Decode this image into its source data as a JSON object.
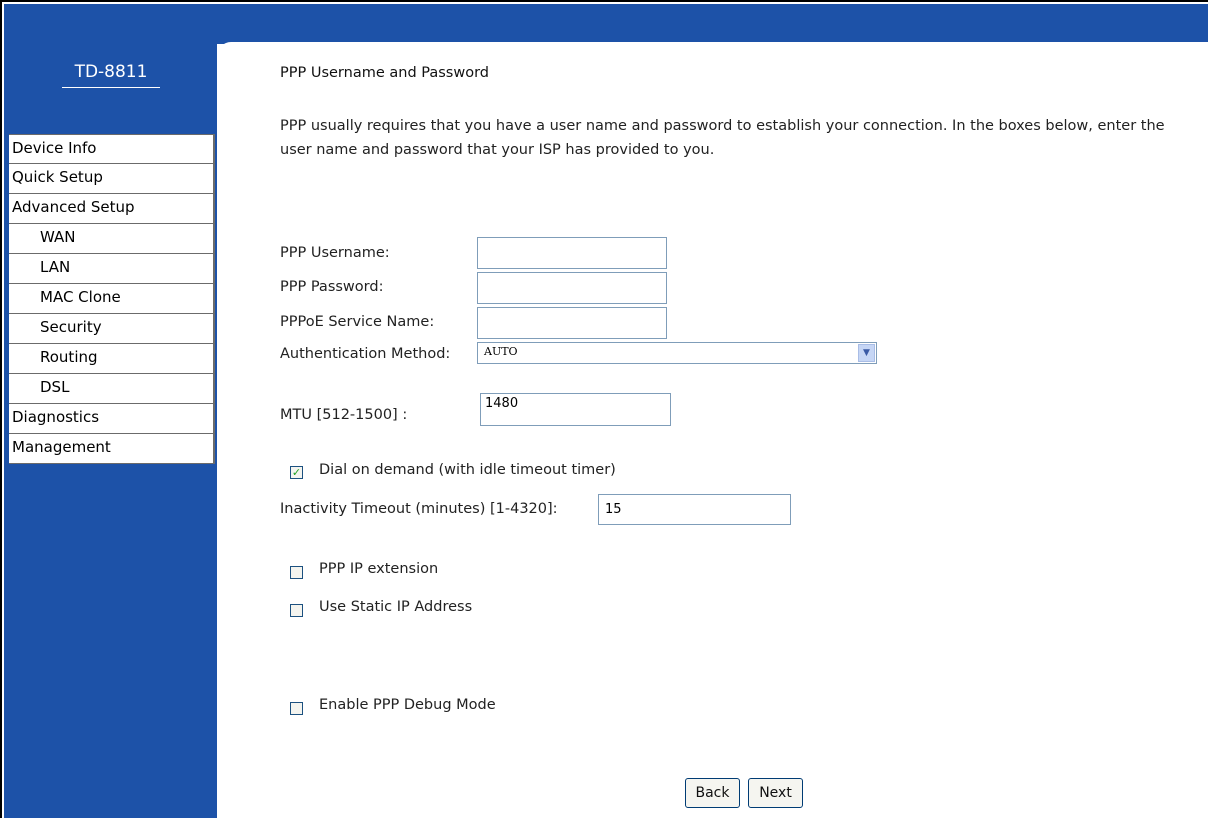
{
  "brand": {
    "title": "TD-8811"
  },
  "colors": {
    "sidebar": "#1d52a8",
    "content_bg": "#ffffff"
  },
  "sidebar": {
    "items": [
      {
        "label": "Device Info"
      },
      {
        "label": "Quick Setup"
      },
      {
        "label": "Advanced Setup"
      },
      {
        "label": "WAN"
      },
      {
        "label": "LAN"
      },
      {
        "label": "MAC Clone"
      },
      {
        "label": "Security"
      },
      {
        "label": "Routing"
      },
      {
        "label": "DSL"
      },
      {
        "label": "Diagnostics"
      },
      {
        "label": "Management"
      }
    ]
  },
  "main": {
    "heading": "PPP Username and Password",
    "description": "PPP usually requires that you have a user name and password to establish your connection. In the boxes below, enter the user name and password that your ISP has provided to you.",
    "form": {
      "username_label": "PPP Username:",
      "username_value": "",
      "password_label": "PPP Password:",
      "password_value": "",
      "service_name_label": "PPPoE Service Name:",
      "service_name_value": "",
      "auth_label": "Authentication Method:",
      "auth_value": "AUTO",
      "mtu_label": "MTU [512-1500] :",
      "mtu_value": "1480",
      "dial_on_demand_label": "Dial on demand (with idle timeout timer)",
      "dial_on_demand_checked": true,
      "inactivity_label": "Inactivity Timeout (minutes) [1-4320]:",
      "inactivity_value": "15",
      "ip_extension_label": "PPP IP extension",
      "ip_extension_checked": false,
      "static_ip_label": "Use Static IP Address",
      "static_ip_checked": false,
      "debug_label": "Enable PPP Debug Mode",
      "debug_checked": false
    },
    "buttons": {
      "back": "Back",
      "next": "Next"
    }
  }
}
